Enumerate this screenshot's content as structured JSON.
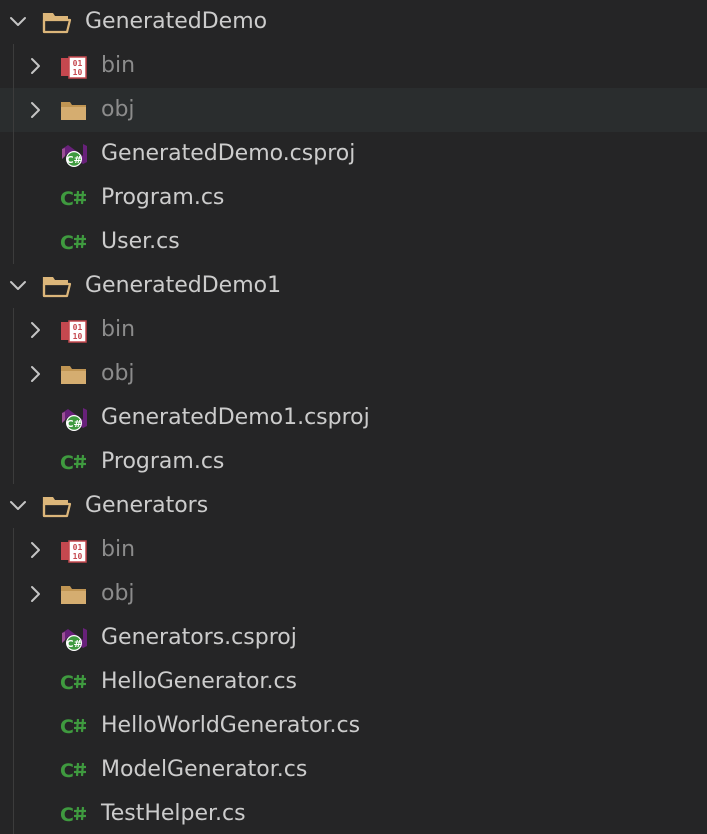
{
  "explorer": {
    "folders": [
      {
        "name": "GeneratedDemo",
        "children": [
          {
            "name": "bin",
            "kind": "bin-folder",
            "icon": "binary-folder-icon"
          },
          {
            "name": "obj",
            "kind": "folder",
            "icon": "folder-icon"
          },
          {
            "name": "GeneratedDemo.csproj",
            "kind": "csproj",
            "icon": "csproj-icon"
          },
          {
            "name": "Program.cs",
            "kind": "cs",
            "icon": "csharp-icon"
          },
          {
            "name": "User.cs",
            "kind": "cs",
            "icon": "csharp-icon"
          }
        ]
      },
      {
        "name": "GeneratedDemo1",
        "children": [
          {
            "name": "bin",
            "kind": "bin-folder",
            "icon": "binary-folder-icon"
          },
          {
            "name": "obj",
            "kind": "folder",
            "icon": "folder-icon"
          },
          {
            "name": "GeneratedDemo1.csproj",
            "kind": "csproj",
            "icon": "csproj-icon"
          },
          {
            "name": "Program.cs",
            "kind": "cs",
            "icon": "csharp-icon"
          }
        ]
      },
      {
        "name": "Generators",
        "children": [
          {
            "name": "bin",
            "kind": "bin-folder",
            "icon": "binary-folder-icon"
          },
          {
            "name": "obj",
            "kind": "folder",
            "icon": "folder-icon"
          },
          {
            "name": "Generators.csproj",
            "kind": "csproj",
            "icon": "csproj-icon"
          },
          {
            "name": "HelloGenerator.cs",
            "kind": "cs",
            "icon": "csharp-icon"
          },
          {
            "name": "HelloWorldGenerator.cs",
            "kind": "cs",
            "icon": "csharp-icon"
          },
          {
            "name": "ModelGenerator.cs",
            "kind": "cs",
            "icon": "csharp-icon"
          },
          {
            "name": "TestHelper.cs",
            "kind": "cs",
            "icon": "csharp-icon"
          }
        ]
      }
    ],
    "colors": {
      "background": "#252526",
      "hover_row": "#2a2d2e",
      "text": "#cccccc",
      "dim_text": "#8c8c8c",
      "folder": "#dcb67a",
      "binary_folder": "#c5484f",
      "csharp": "#3f9a3f",
      "vs_purple": "#68217a"
    },
    "hovered_row": "GeneratedDemo/obj"
  }
}
